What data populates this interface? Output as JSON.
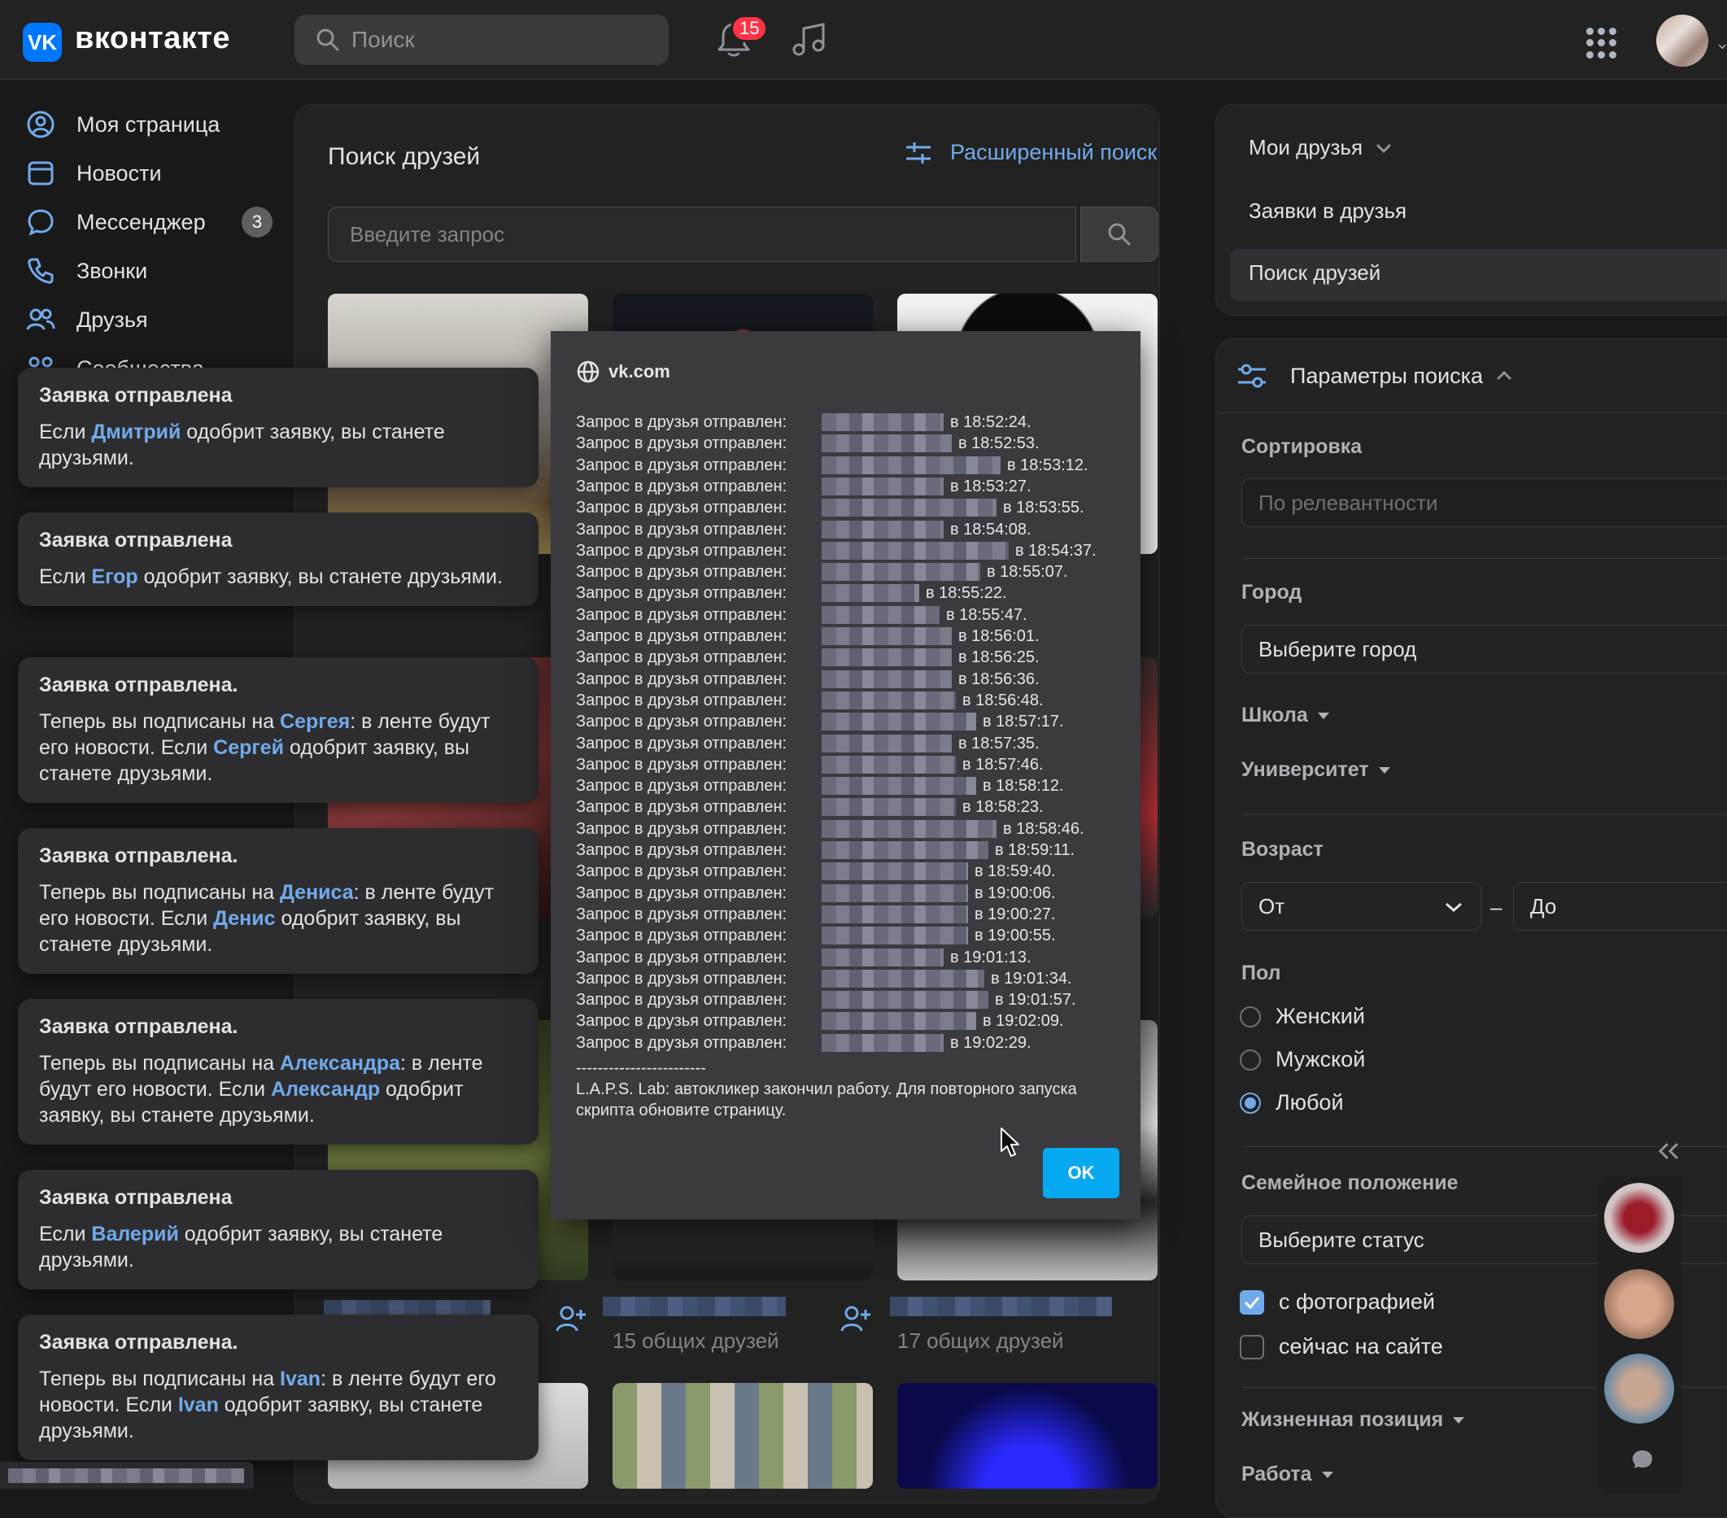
{
  "header": {
    "logo_letter": "VK",
    "logo_text": "вконтакте",
    "search_placeholder": "Поиск",
    "notifications_count": "15"
  },
  "nav": {
    "items": [
      {
        "label": "Моя страница",
        "icon": "user-circle-icon"
      },
      {
        "label": "Новости",
        "icon": "newspaper-icon"
      },
      {
        "label": "Мессенджер",
        "icon": "chat-bubble-icon",
        "badge": "3"
      },
      {
        "label": "Звонки",
        "icon": "phone-icon"
      },
      {
        "label": "Друзья",
        "icon": "friends-icon"
      },
      {
        "label": "Сообщества",
        "icon": "community-icon"
      }
    ]
  },
  "center": {
    "title": "Поиск друзей",
    "advanced_search": "Расширенный поиск",
    "query_placeholder": "Введите запрос",
    "mutual": [
      "15 общих друзей",
      "17 общих друзей"
    ]
  },
  "right_menu": {
    "items": [
      "Мои друзья",
      "Заявки в друзья",
      "Поиск друзей"
    ]
  },
  "params": {
    "title": "Параметры поиска",
    "sort_label": "Сортировка",
    "sort_value": "По релевантности",
    "city_label": "Город",
    "city_value": "Выберите город",
    "school": "Школа",
    "university": "Университет",
    "age_label": "Возраст",
    "age_from": "От",
    "age_dash": "–",
    "age_to": "До",
    "gender_label": "Пол",
    "gender_options": [
      "Женский",
      "Мужской",
      "Любой"
    ],
    "family_label": "Семейное положение",
    "family_value": "Выберите статус",
    "with_photo": "с фотографией",
    "online_now": "сейчас на сайте",
    "life_position": "Жизненная позиция",
    "work": "Работа"
  },
  "toasts": [
    {
      "title": "Заявка отправлена",
      "pre": "Если ",
      "name": "Дмитрий",
      "post": " одобрит заявку, вы станете друзьями."
    },
    {
      "title": "Заявка отправлена",
      "pre": "Если ",
      "name": "Егор",
      "post": " одобрит заявку, вы станете друзьями."
    },
    {
      "title": "Заявка отправлена.",
      "pre": "Теперь вы подписаны на ",
      "name": "Сергея",
      "mid": ": в ленте будут его новости. Если ",
      "name2": "Сергей",
      "post": " одобрит заявку, вы станете друзьями."
    },
    {
      "title": "Заявка отправлена.",
      "pre": "Теперь вы подписаны на ",
      "name": "Дениса",
      "mid": ": в ленте будут его новости. Если ",
      "name2": "Денис",
      "post": " одобрит заявку, вы станете друзьями."
    },
    {
      "title": "Заявка отправлена.",
      "pre": "Теперь вы подписаны на ",
      "name": "Александра",
      "mid": ": в ленте будут его новости. Если ",
      "name2": "Александр",
      "post": " одобрит заявку, вы станете друзьями."
    },
    {
      "title": "Заявка отправлена",
      "pre": "Если ",
      "name": "Валерий",
      "post": " одобрит заявку, вы станете друзьями."
    },
    {
      "title": "Заявка отправлена.",
      "pre": "Теперь вы подписаны на ",
      "name": "Ivan",
      "mid": ": в ленте будут его новости. Если ",
      "name2": "Ivan",
      "post": " одобрит заявку, вы станете друзьями."
    }
  ],
  "dialog": {
    "host": "vk.com",
    "line_prefix": "Запрос в друзья отправлен:",
    "times": [
      "в 18:52:24.",
      "в 18:52:53.",
      "в 18:53:12.",
      "в 18:53:27.",
      "в 18:53:55.",
      "в 18:54:08.",
      "в 18:54:37.",
      "в 18:55:07.",
      "в 18:55:22.",
      "в 18:55:47.",
      "в 18:56:01.",
      "в 18:56:25.",
      "в 18:56:36.",
      "в 18:56:48.",
      "в 18:57:17.",
      "в 18:57:35.",
      "в 18:57:46.",
      "в 18:58:12.",
      "в 18:58:23.",
      "в 18:58:46.",
      "в 18:59:11.",
      "в 18:59:40.",
      "в 19:00:06.",
      "в 19:00:27.",
      "в 19:00:55.",
      "в 19:01:13.",
      "в 19:01:34.",
      "в 19:01:57.",
      "в 19:02:09.",
      "в 19:02:29."
    ],
    "separator": "------------------------",
    "message": "L.A.P.S. Lab: автокликер закончил работу. Для повторного запуска скрипта обновите страницу.",
    "ok": "OK"
  },
  "colors": {
    "accent": "#71aaeb",
    "vk_blue": "#0077ff",
    "badge_red": "#ff3347",
    "ok_button": "#06a8f0"
  }
}
